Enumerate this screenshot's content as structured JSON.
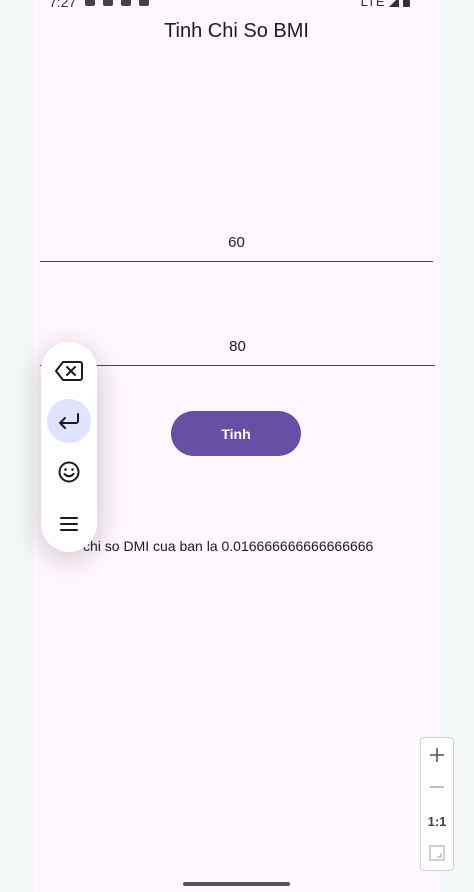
{
  "status_bar": {
    "time": "7:27",
    "network": "LTE"
  },
  "app": {
    "title": "Tinh Chi So BMI"
  },
  "form": {
    "field1_value": "60",
    "field2_value": "80",
    "submit_label": "Tinh",
    "result_text": "chi so DMI cua ban la 0.016666666666666666"
  },
  "zoom_controls": {
    "reset_label": "1:1"
  },
  "floating_toolbar": {
    "items": [
      "backspace-icon",
      "enter-icon",
      "emoji-icon",
      "menu-icon"
    ]
  }
}
